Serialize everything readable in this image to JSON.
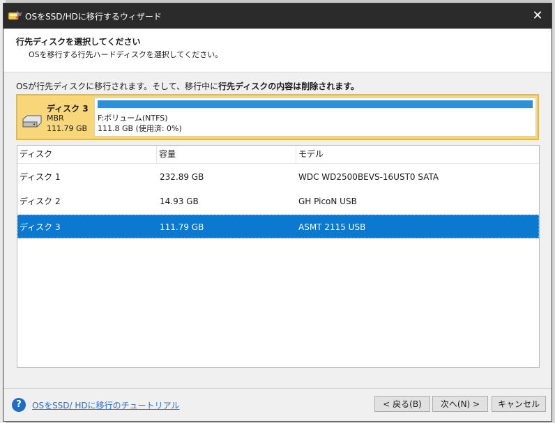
{
  "window": {
    "title": "OSをSSD/HDに移行するウィザード",
    "close_glyph": "✕"
  },
  "header": {
    "heading": "行先ディスクを選択してください",
    "subheading": "OSを移行する行先ハードディスクを選択してください。"
  },
  "info": {
    "text_prefix": "OSが行先ディスクに移行されます。そして、移行中に",
    "text_bold": "行先ディスクの内容は削除されます。"
  },
  "selected_disk": {
    "name": "ディスク 3",
    "type": "MBR",
    "size": "111.79 GB",
    "icon": "hard-drive-icon",
    "partition": {
      "name": "F:ボリューム(NTFS)",
      "info": "111.8 GB (使用済: 0%)",
      "used_fraction": 0,
      "bar_color": "#2f8fd6"
    }
  },
  "table": {
    "columns": [
      "ディスク",
      "容量",
      "モデル"
    ],
    "rows": [
      {
        "disk": "ディスク 1",
        "capacity": "232.89 GB",
        "model": "WDC WD2500BEVS-16UST0 SATA"
      },
      {
        "disk": "ディスク 2",
        "capacity": "14.93 GB",
        "model": "GH PicoN USB"
      },
      {
        "disk": "ディスク 3",
        "capacity": "111.79 GB",
        "model": "ASMT 2115 USB"
      }
    ],
    "selected_index": 2,
    "selection_color": "#0b79d0"
  },
  "footer": {
    "help_icon": "question-icon",
    "help_glyph": "?",
    "tutorial_link": "OSをSSD/ HDに移行のチュートリアル",
    "back_label": "< 戻る(B)",
    "next_label": "次へ(N) >",
    "cancel_label": "キャンセル"
  }
}
